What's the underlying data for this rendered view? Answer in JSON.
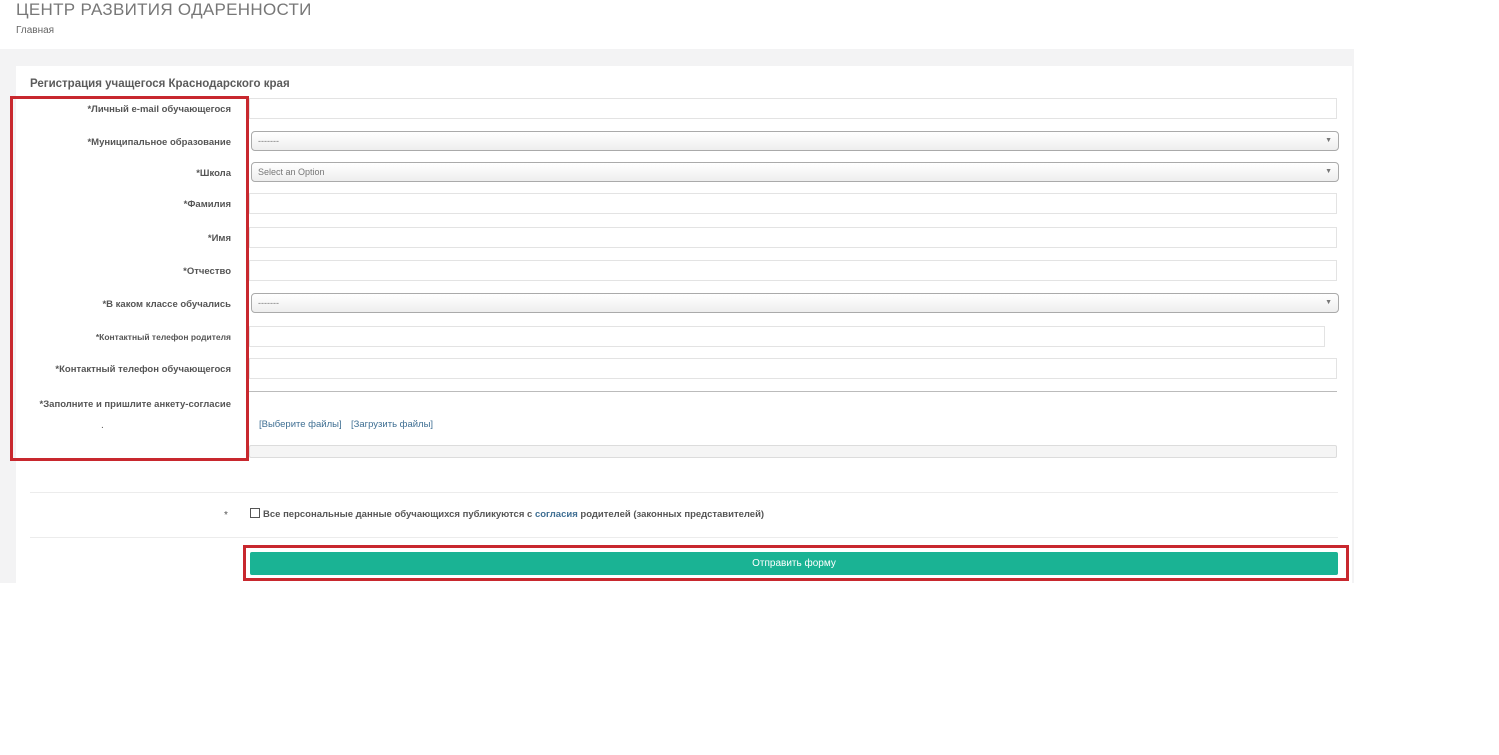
{
  "header": {
    "site_title": "ЦЕНТР РАЗВИТИЯ ОДАРЕННОСТИ",
    "breadcrumb": "Главная"
  },
  "form": {
    "title": "Регистрация учащегося Краснодарского края",
    "fields": {
      "email_label": "*Личный e-mail обучающегося",
      "municipality_label": "*Муниципальное образование",
      "municipality_value": "-------",
      "school_label": "*Школа",
      "school_placeholder": "Select an Option",
      "lastname_label": "*Фамилия",
      "firstname_label": "*Имя",
      "patronymic_label": "*Отчество",
      "grade_label": "*В каком классе обучались",
      "grade_value": "-------",
      "parent_phone_label": "*Контактный телефон родителя",
      "student_phone_label": "*Контактный телефон  обучающегося",
      "consent_file_label": "*Заполните и пришлите анкету-согласие",
      "consent_file_dot": "."
    },
    "upload": {
      "choose_files": "[Выберите файлы]",
      "upload_files": "[Загрузить файлы]"
    },
    "consent": {
      "asterisk": "*",
      "text_before": "Все персональные данные обучающихся публикуются с ",
      "link": "согласия",
      "text_after": " родителей (законных представителей)"
    },
    "submit_label": "Отправить форму"
  },
  "colors": {
    "submit_bg": "#1ab394",
    "highlight_border": "#c8282e"
  }
}
